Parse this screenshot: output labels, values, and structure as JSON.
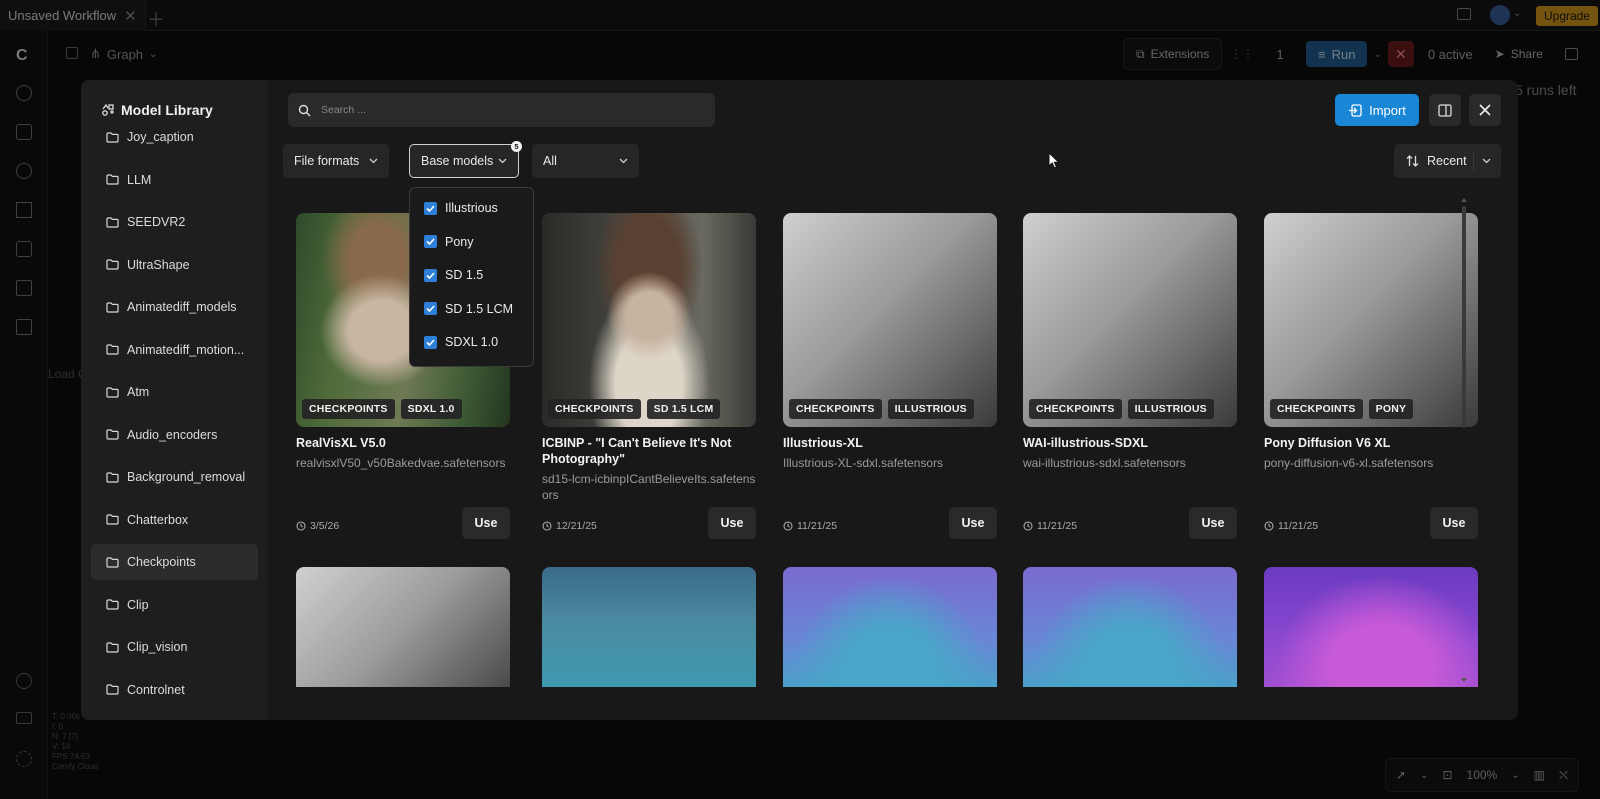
{
  "app": {
    "workflow_tab": "Unsaved Workflow",
    "graph_label": "Graph",
    "extensions_label": "Extensions",
    "queue_count": "1",
    "run_label": "Run",
    "active_label": "0 active",
    "share_label": "Share",
    "upgrade_label": "Upgrade",
    "runs_left_label": "5 runs left",
    "load_label": "Load C",
    "stats": [
      "T: 0.00s",
      "I: 0",
      "N: 7 [7]",
      "V: 14",
      "FPS:74.63",
      "Comfy Cloud"
    ],
    "zoom_label": "100%"
  },
  "modal": {
    "title": "Model Library",
    "search_placeholder": "Search ...",
    "import_label": "Import",
    "filters": {
      "file_formats": "File formats",
      "base_models": "Base models",
      "base_models_badge": "5",
      "all": "All"
    },
    "sort_label": "Recent",
    "folders": [
      {
        "label": "Joy_caption"
      },
      {
        "label": "LLM"
      },
      {
        "label": "SEEDVR2"
      },
      {
        "label": "UltraShape"
      },
      {
        "label": "Animatediff_models"
      },
      {
        "label": "Animatediff_motion..."
      },
      {
        "label": "Atm"
      },
      {
        "label": "Audio_encoders"
      },
      {
        "label": "Background_removal"
      },
      {
        "label": "Chatterbox"
      },
      {
        "label": "Checkpoints"
      },
      {
        "label": "Clip"
      },
      {
        "label": "Clip_vision"
      },
      {
        "label": "Controlnet"
      }
    ],
    "active_folder": "Checkpoints",
    "base_model_options": [
      {
        "label": "Illustrious",
        "checked": true
      },
      {
        "label": "Pony",
        "checked": true
      },
      {
        "label": "SD 1.5",
        "checked": true
      },
      {
        "label": "SD 1.5 LCM",
        "checked": true
      },
      {
        "label": "SDXL 1.0",
        "checked": true
      }
    ],
    "use_label": "Use",
    "models": [
      {
        "name": "RealVisXL V5.0",
        "file": "realvisxlV50_v50Bakedvae.safetensors",
        "date": "3/5/26",
        "tags": [
          "CHECKPOINTS",
          "SDXL 1.0"
        ]
      },
      {
        "name": "ICBINP - \"I Can't Believe It's Not Photography\"",
        "file": "sd15-lcm-icbinpICantBelieveIts.safetensors",
        "date": "12/21/25",
        "tags": [
          "CHECKPOINTS",
          "SD 1.5 LCM"
        ]
      },
      {
        "name": "Illustrious-XL",
        "file": "Illustrious-XL-sdxl.safetensors",
        "date": "11/21/25",
        "tags": [
          "CHECKPOINTS",
          "ILLUSTRIOUS"
        ]
      },
      {
        "name": "WAI-illustrious-SDXL",
        "file": "wai-illustrious-sdxl.safetensors",
        "date": "11/21/25",
        "tags": [
          "CHECKPOINTS",
          "ILLUSTRIOUS"
        ]
      },
      {
        "name": "Pony Diffusion V6 XL",
        "file": "pony-diffusion-v6-xl.safetensors",
        "date": "11/21/25",
        "tags": [
          "CHECKPOINTS",
          "PONY"
        ]
      }
    ]
  }
}
